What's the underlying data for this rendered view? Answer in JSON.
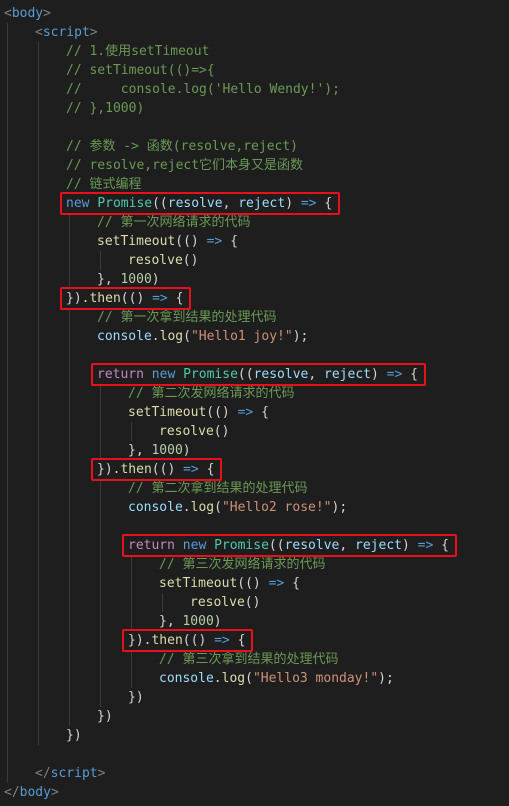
{
  "editor": {
    "lines": [
      {
        "indent": 0,
        "tokens": [
          {
            "t": "<",
            "c": "punct"
          },
          {
            "t": "body",
            "c": "tag"
          },
          {
            "t": ">",
            "c": "punct"
          }
        ]
      },
      {
        "indent": 1,
        "tokens": [
          {
            "t": "<",
            "c": "punct"
          },
          {
            "t": "script",
            "c": "tag"
          },
          {
            "t": ">",
            "c": "punct"
          }
        ]
      },
      {
        "indent": 2,
        "tokens": [
          {
            "t": "// 1.使用setTimeout",
            "c": "cmt"
          }
        ]
      },
      {
        "indent": 2,
        "tokens": [
          {
            "t": "// setTimeout(()=>{",
            "c": "cmt"
          }
        ]
      },
      {
        "indent": 2,
        "tokens": [
          {
            "t": "//     console.log('Hello Wendy!');",
            "c": "cmt"
          }
        ]
      },
      {
        "indent": 2,
        "tokens": [
          {
            "t": "// },1000)",
            "c": "cmt"
          }
        ]
      },
      {
        "indent": 0,
        "tokens": []
      },
      {
        "indent": 2,
        "tokens": [
          {
            "t": "// 参数 -> 函数(resolve,reject)",
            "c": "cmt"
          }
        ]
      },
      {
        "indent": 2,
        "tokens": [
          {
            "t": "// resolve,reject它们本身又是函数",
            "c": "cmt"
          }
        ]
      },
      {
        "indent": 2,
        "tokens": [
          {
            "t": "// 链式编程",
            "c": "cmt"
          }
        ]
      },
      {
        "indent": 2,
        "tokens": [
          {
            "t": "new ",
            "c": "kw"
          },
          {
            "t": "Promise",
            "c": "cls"
          },
          {
            "t": "((",
            "c": "plain"
          },
          {
            "t": "resolve",
            "c": "param"
          },
          {
            "t": ", ",
            "c": "plain"
          },
          {
            "t": "reject",
            "c": "param"
          },
          {
            "t": ") ",
            "c": "plain"
          },
          {
            "t": "=>",
            "c": "kw"
          },
          {
            "t": " {",
            "c": "plain"
          }
        ]
      },
      {
        "indent": 3,
        "tokens": [
          {
            "t": "// 第一次网络请求的代码",
            "c": "cmt"
          }
        ]
      },
      {
        "indent": 3,
        "tokens": [
          {
            "t": "setTimeout",
            "c": "fn"
          },
          {
            "t": "(() ",
            "c": "plain"
          },
          {
            "t": "=>",
            "c": "kw"
          },
          {
            "t": " {",
            "c": "plain"
          }
        ]
      },
      {
        "indent": 4,
        "tokens": [
          {
            "t": "resolve",
            "c": "fn"
          },
          {
            "t": "()",
            "c": "plain"
          }
        ]
      },
      {
        "indent": 3,
        "tokens": [
          {
            "t": "}, ",
            "c": "plain"
          },
          {
            "t": "1000",
            "c": "num"
          },
          {
            "t": ")",
            "c": "plain"
          }
        ]
      },
      {
        "indent": 2,
        "tokens": [
          {
            "t": "}).",
            "c": "plain"
          },
          {
            "t": "then",
            "c": "fn"
          },
          {
            "t": "(() ",
            "c": "plain"
          },
          {
            "t": "=>",
            "c": "kw"
          },
          {
            "t": " {",
            "c": "plain"
          }
        ]
      },
      {
        "indent": 3,
        "tokens": [
          {
            "t": "// 第一次拿到结果的处理代码",
            "c": "cmt"
          }
        ]
      },
      {
        "indent": 3,
        "tokens": [
          {
            "t": "console",
            "c": "param"
          },
          {
            "t": ".",
            "c": "plain"
          },
          {
            "t": "log",
            "c": "fn"
          },
          {
            "t": "(",
            "c": "plain"
          },
          {
            "t": "\"Hello1 joy!\"",
            "c": "str"
          },
          {
            "t": ");",
            "c": "plain"
          }
        ]
      },
      {
        "indent": 0,
        "tokens": []
      },
      {
        "indent": 3,
        "tokens": [
          {
            "t": "return",
            "c": "ctl"
          },
          {
            "t": " ",
            "c": "plain"
          },
          {
            "t": "new ",
            "c": "kw"
          },
          {
            "t": "Promise",
            "c": "cls"
          },
          {
            "t": "((",
            "c": "plain"
          },
          {
            "t": "resolve",
            "c": "param"
          },
          {
            "t": ", ",
            "c": "plain"
          },
          {
            "t": "reject",
            "c": "param"
          },
          {
            "t": ") ",
            "c": "plain"
          },
          {
            "t": "=>",
            "c": "kw"
          },
          {
            "t": " {",
            "c": "plain"
          }
        ]
      },
      {
        "indent": 4,
        "tokens": [
          {
            "t": "// 第二次发网络请求的代码",
            "c": "cmt"
          }
        ]
      },
      {
        "indent": 4,
        "tokens": [
          {
            "t": "setTimeout",
            "c": "fn"
          },
          {
            "t": "(() ",
            "c": "plain"
          },
          {
            "t": "=>",
            "c": "kw"
          },
          {
            "t": " {",
            "c": "plain"
          }
        ]
      },
      {
        "indent": 5,
        "tokens": [
          {
            "t": "resolve",
            "c": "fn"
          },
          {
            "t": "()",
            "c": "plain"
          }
        ]
      },
      {
        "indent": 4,
        "tokens": [
          {
            "t": "}, ",
            "c": "plain"
          },
          {
            "t": "1000",
            "c": "num"
          },
          {
            "t": ")",
            "c": "plain"
          }
        ]
      },
      {
        "indent": 3,
        "tokens": [
          {
            "t": "}).",
            "c": "plain"
          },
          {
            "t": "then",
            "c": "fn"
          },
          {
            "t": "(() ",
            "c": "plain"
          },
          {
            "t": "=>",
            "c": "kw"
          },
          {
            "t": " {",
            "c": "plain"
          }
        ]
      },
      {
        "indent": 4,
        "tokens": [
          {
            "t": "// 第二次拿到结果的处理代码",
            "c": "cmt"
          }
        ]
      },
      {
        "indent": 4,
        "tokens": [
          {
            "t": "console",
            "c": "param"
          },
          {
            "t": ".",
            "c": "plain"
          },
          {
            "t": "log",
            "c": "fn"
          },
          {
            "t": "(",
            "c": "plain"
          },
          {
            "t": "\"Hello2 rose!\"",
            "c": "str"
          },
          {
            "t": ");",
            "c": "plain"
          }
        ]
      },
      {
        "indent": 0,
        "tokens": []
      },
      {
        "indent": 4,
        "tokens": [
          {
            "t": "return",
            "c": "ctl"
          },
          {
            "t": " ",
            "c": "plain"
          },
          {
            "t": "new ",
            "c": "kw"
          },
          {
            "t": "Promise",
            "c": "cls"
          },
          {
            "t": "((",
            "c": "plain"
          },
          {
            "t": "resolve",
            "c": "param"
          },
          {
            "t": ", ",
            "c": "plain"
          },
          {
            "t": "reject",
            "c": "param"
          },
          {
            "t": ") ",
            "c": "plain"
          },
          {
            "t": "=>",
            "c": "kw"
          },
          {
            "t": " {",
            "c": "plain"
          }
        ]
      },
      {
        "indent": 5,
        "tokens": [
          {
            "t": "// 第三次发网络请求的代码",
            "c": "cmt"
          }
        ]
      },
      {
        "indent": 5,
        "tokens": [
          {
            "t": "setTimeout",
            "c": "fn"
          },
          {
            "t": "(() ",
            "c": "plain"
          },
          {
            "t": "=>",
            "c": "kw"
          },
          {
            "t": " {",
            "c": "plain"
          }
        ]
      },
      {
        "indent": 6,
        "tokens": [
          {
            "t": "resolve",
            "c": "fn"
          },
          {
            "t": "()",
            "c": "plain"
          }
        ]
      },
      {
        "indent": 5,
        "tokens": [
          {
            "t": "}, ",
            "c": "plain"
          },
          {
            "t": "1000",
            "c": "num"
          },
          {
            "t": ")",
            "c": "plain"
          }
        ]
      },
      {
        "indent": 4,
        "tokens": [
          {
            "t": "}).",
            "c": "plain"
          },
          {
            "t": "then",
            "c": "fn"
          },
          {
            "t": "(() ",
            "c": "plain"
          },
          {
            "t": "=>",
            "c": "kw"
          },
          {
            "t": " {",
            "c": "plain"
          }
        ]
      },
      {
        "indent": 5,
        "tokens": [
          {
            "t": "// 第三次拿到结果的处理代码",
            "c": "cmt"
          }
        ]
      },
      {
        "indent": 5,
        "tokens": [
          {
            "t": "console",
            "c": "param"
          },
          {
            "t": ".",
            "c": "plain"
          },
          {
            "t": "log",
            "c": "fn"
          },
          {
            "t": "(",
            "c": "plain"
          },
          {
            "t": "\"Hello3 monday!\"",
            "c": "str"
          },
          {
            "t": ");",
            "c": "plain"
          }
        ]
      },
      {
        "indent": 4,
        "tokens": [
          {
            "t": "})",
            "c": "plain"
          }
        ]
      },
      {
        "indent": 3,
        "tokens": [
          {
            "t": "})",
            "c": "plain"
          }
        ]
      },
      {
        "indent": 2,
        "tokens": [
          {
            "t": "})",
            "c": "plain"
          }
        ]
      },
      {
        "indent": 0,
        "tokens": []
      },
      {
        "indent": 1,
        "tokens": [
          {
            "t": "</",
            "c": "punct"
          },
          {
            "t": "script",
            "c": "tag"
          },
          {
            "t": ">",
            "c": "punct"
          }
        ]
      },
      {
        "indent": 0,
        "tokens": [
          {
            "t": "</",
            "c": "punct"
          },
          {
            "t": "body",
            "c": "tag"
          },
          {
            "t": ">",
            "c": "punct"
          }
        ]
      }
    ],
    "highlighted_lines": [
      10,
      15,
      19,
      24,
      28,
      33
    ],
    "colors": {
      "background": "#1e1e1e",
      "highlight_border": "#e8101a",
      "comment": "#6a9955",
      "keyword": "#569cd6",
      "control_keyword": "#c586c0",
      "class": "#4ec9b0",
      "function": "#dcdcaa",
      "parameter": "#9cdcfe",
      "number": "#b5cea8",
      "string": "#ce9178"
    }
  }
}
